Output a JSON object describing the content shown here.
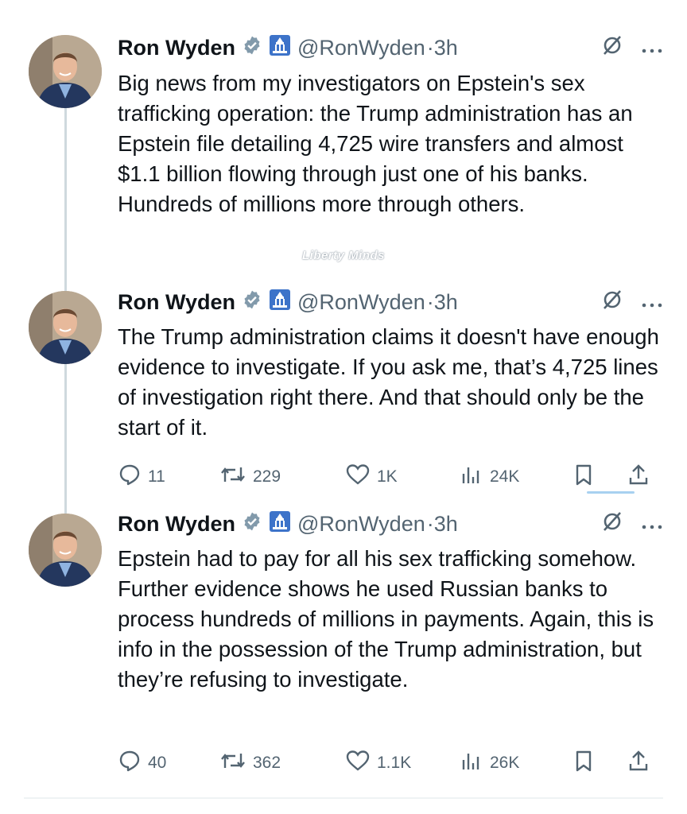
{
  "tweets": [
    {
      "author": "Ron Wyden",
      "handle": "@RonWyden",
      "time": "·3h",
      "text": "Big news from my investigators on Epstein's sex trafficking operation: the Trump administration has an Epstein file detailing 4,725 wire transfers and almost $1.1 billion flowing through just one of his banks. Hundreds of millions more through others."
    },
    {
      "author": "Ron Wyden",
      "handle": "@RonWyden",
      "time": "·3h",
      "text": "The Trump administration claims it doesn't have enough evidence to investigate. If you ask me, that’s 4,725 lines of investigation right there. And that should only be the start of it.",
      "replies": "11",
      "reposts": "229",
      "likes": "1K",
      "views": "24K"
    },
    {
      "author": "Ron Wyden",
      "handle": "@RonWyden",
      "time": "·3h",
      "text": "Epstein had to pay for all his sex trafficking somehow. Further evidence shows he used Russian banks to process hundreds of millions in payments. Again, this is info in the possession of the Trump administration, but they’re refusing to investigate.",
      "replies": "40",
      "reposts": "362",
      "likes": "1.1K",
      "views": "26K"
    }
  ],
  "watermark": "Liberty Minds",
  "colors": {
    "text": "#0f1419",
    "secondary": "#536471",
    "verified_blue": "#829aab",
    "gov_badge": "#3d73c9"
  },
  "icons": [
    "verified-badge-icon",
    "capitol-badge-icon",
    "grok-icon",
    "more-icon",
    "reply-icon",
    "repost-icon",
    "like-icon",
    "views-icon",
    "bookmark-icon",
    "share-icon"
  ]
}
